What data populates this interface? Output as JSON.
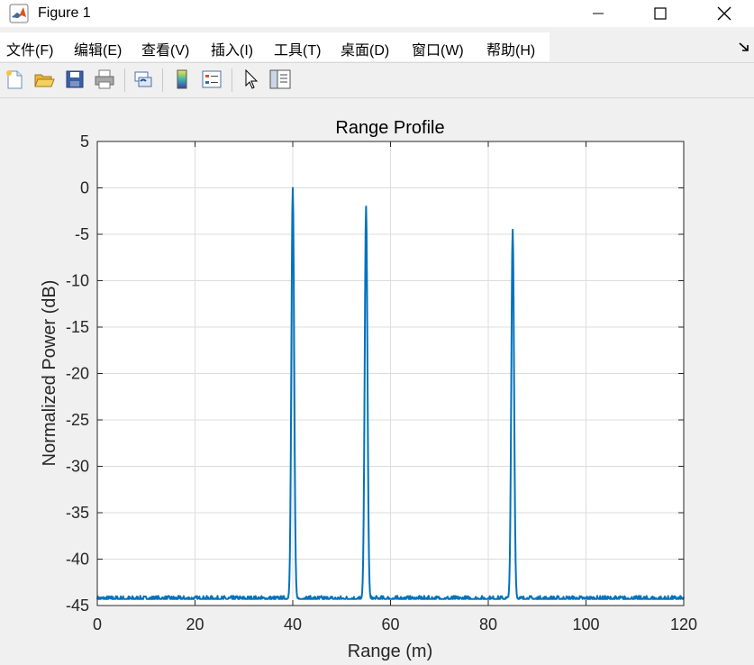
{
  "window": {
    "title": "Figure 1"
  },
  "menu": {
    "items": [
      "文件(F)",
      "编辑(E)",
      "查看(V)",
      "插入(I)",
      "工具(T)",
      "桌面(D)",
      "窗口(W)",
      "帮助(H)"
    ]
  },
  "toolbar": {
    "buttons": [
      "new-figure-icon",
      "open-file-icon",
      "save-icon",
      "print-icon",
      "link-plot-icon",
      "colorbar-icon",
      "legend-icon",
      "pointer-icon",
      "property-inspector-icon"
    ]
  },
  "colors": {
    "line": "#0072bd",
    "grid": "#dcdcdc",
    "axes_bg": "#ffffff",
    "figure_bg": "#f0f0f0"
  },
  "chart_data": {
    "type": "line",
    "title": "Range Profile",
    "xlabel": "Range (m)",
    "ylabel": "Normalized Power (dB)",
    "xlim": [
      0,
      120
    ],
    "ylim": [
      -45,
      5
    ],
    "xticks": [
      0,
      20,
      40,
      60,
      80,
      100,
      120
    ],
    "yticks": [
      5,
      0,
      -5,
      -10,
      -15,
      -20,
      -25,
      -30,
      -35,
      -40,
      -45
    ],
    "grid": true,
    "noise_floor_db": -44.3,
    "series": [
      {
        "peaks": [
          {
            "range_m": 40,
            "power_db": 0
          },
          {
            "range_m": 55,
            "power_db": -2
          },
          {
            "range_m": 85,
            "power_db": -4.5
          }
        ]
      }
    ]
  }
}
